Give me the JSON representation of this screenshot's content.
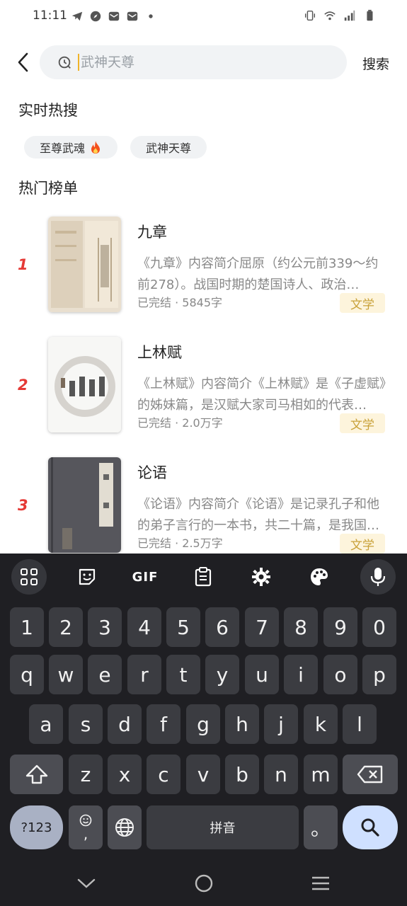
{
  "status_bar": {
    "time": "11:11"
  },
  "search": {
    "placeholder": "武神天尊",
    "action_label": "搜索"
  },
  "hot_search": {
    "title": "实时热搜",
    "chips": [
      {
        "label": "至尊武魂",
        "hot": true
      },
      {
        "label": "武神天尊",
        "hot": false
      }
    ]
  },
  "ranking": {
    "title": "热门榜单",
    "books": [
      {
        "rank": "1",
        "title": "九章",
        "desc": "《九章》内容简介屈原（约公元前339～约前278）。战国时期的楚国诗人、政治…",
        "status": "已完结",
        "words": "5845字",
        "tag": "文学"
      },
      {
        "rank": "2",
        "title": "上林赋",
        "desc": "《上林赋》内容简介《上林赋》是《子虚赋》的姊妹篇，是汉赋大家司马相如的代表…",
        "status": "已完结",
        "words": "2.0万字",
        "tag": "文学"
      },
      {
        "rank": "3",
        "title": "论语",
        "desc": "《论语》内容简介《论语》是记录孔子和他的弟子言行的一本书，共二十篇，是我国…",
        "status": "已完结",
        "words": "2.5万字",
        "tag": "文学"
      }
    ]
  },
  "keyboard": {
    "toolbar": {
      "gif_label": "GIF"
    },
    "row_numbers": [
      "1",
      "2",
      "3",
      "4",
      "5",
      "6",
      "7",
      "8",
      "9",
      "0"
    ],
    "row1": [
      "q",
      "w",
      "e",
      "r",
      "t",
      "y",
      "u",
      "i",
      "o",
      "p"
    ],
    "row2": [
      "a",
      "s",
      "d",
      "f",
      "g",
      "h",
      "j",
      "k",
      "l"
    ],
    "row3": [
      "z",
      "x",
      "c",
      "v",
      "b",
      "n",
      "m"
    ],
    "symbols_label": "?123",
    "emoji_comma_label": ",",
    "space_label": "拼音",
    "period_label": "。"
  },
  "colors": {
    "accent_rank": "#e53935",
    "tag_bg": "#fdf4dc",
    "tag_text": "#c9a23a",
    "keyboard_bg": "#1f1f23"
  }
}
